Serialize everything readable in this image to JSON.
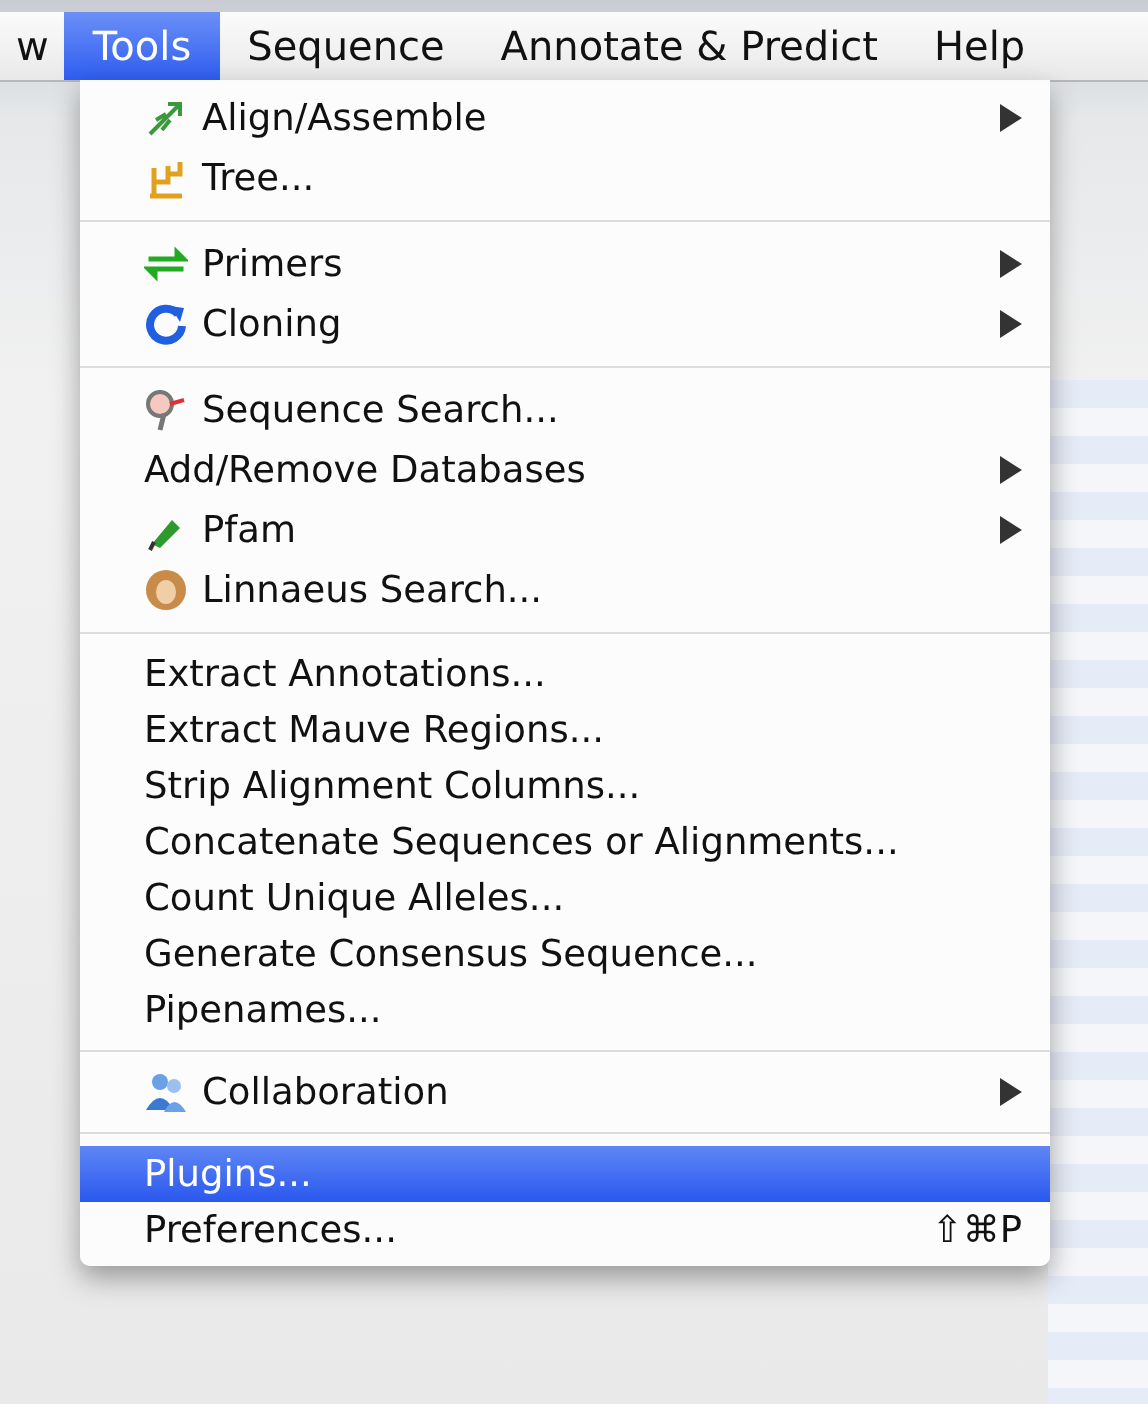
{
  "menubar": [
    {
      "label": "w",
      "selected": false
    },
    {
      "label": "Tools",
      "selected": true
    },
    {
      "label": "Sequence",
      "selected": false
    },
    {
      "label": "Annotate & Predict",
      "selected": false
    },
    {
      "label": "Help",
      "selected": false
    }
  ],
  "menu": {
    "sections": [
      {
        "items": [
          {
            "label": "Align/Assemble",
            "kind": "icon",
            "submenu": true,
            "selected": false
          },
          {
            "label": "Tree...",
            "kind": "icon",
            "submenu": false,
            "selected": false
          }
        ]
      },
      {
        "items": [
          {
            "label": "Primers",
            "kind": "icon",
            "submenu": true,
            "selected": false
          },
          {
            "label": "Cloning",
            "kind": "icon",
            "submenu": true,
            "selected": false
          }
        ]
      },
      {
        "items": [
          {
            "label": "Sequence Search...",
            "kind": "icon",
            "submenu": false,
            "selected": false
          },
          {
            "label": "Add/Remove Databases",
            "kind": "plain",
            "submenu": true,
            "selected": false
          },
          {
            "label": "Pfam",
            "kind": "icon",
            "submenu": true,
            "selected": false
          },
          {
            "label": "Linnaeus Search...",
            "kind": "icon",
            "submenu": false,
            "selected": false
          }
        ]
      },
      {
        "items": [
          {
            "label": "Extract Annotations...",
            "kind": "plain",
            "submenu": false,
            "selected": false
          },
          {
            "label": "Extract Mauve Regions...",
            "kind": "plain",
            "submenu": false,
            "selected": false
          },
          {
            "label": "Strip Alignment Columns...",
            "kind": "plain",
            "submenu": false,
            "selected": false
          },
          {
            "label": "Concatenate Sequences or Alignments...",
            "kind": "plain",
            "submenu": false,
            "selected": false
          },
          {
            "label": "Count Unique Alleles...",
            "kind": "plain",
            "submenu": false,
            "selected": false
          },
          {
            "label": "Generate Consensus Sequence...",
            "kind": "plain",
            "submenu": false,
            "selected": false
          },
          {
            "label": "Pipenames...",
            "kind": "plain",
            "submenu": false,
            "selected": false
          }
        ]
      },
      {
        "items": [
          {
            "label": "Collaboration",
            "kind": "icon",
            "submenu": true,
            "selected": false
          }
        ]
      },
      {
        "items": [
          {
            "label": "Plugins...",
            "kind": "plain",
            "submenu": false,
            "selected": true
          },
          {
            "label": "Preferences...",
            "kind": "plain",
            "submenu": false,
            "selected": false,
            "shortcut": "⇧⌘P"
          }
        ]
      }
    ]
  }
}
